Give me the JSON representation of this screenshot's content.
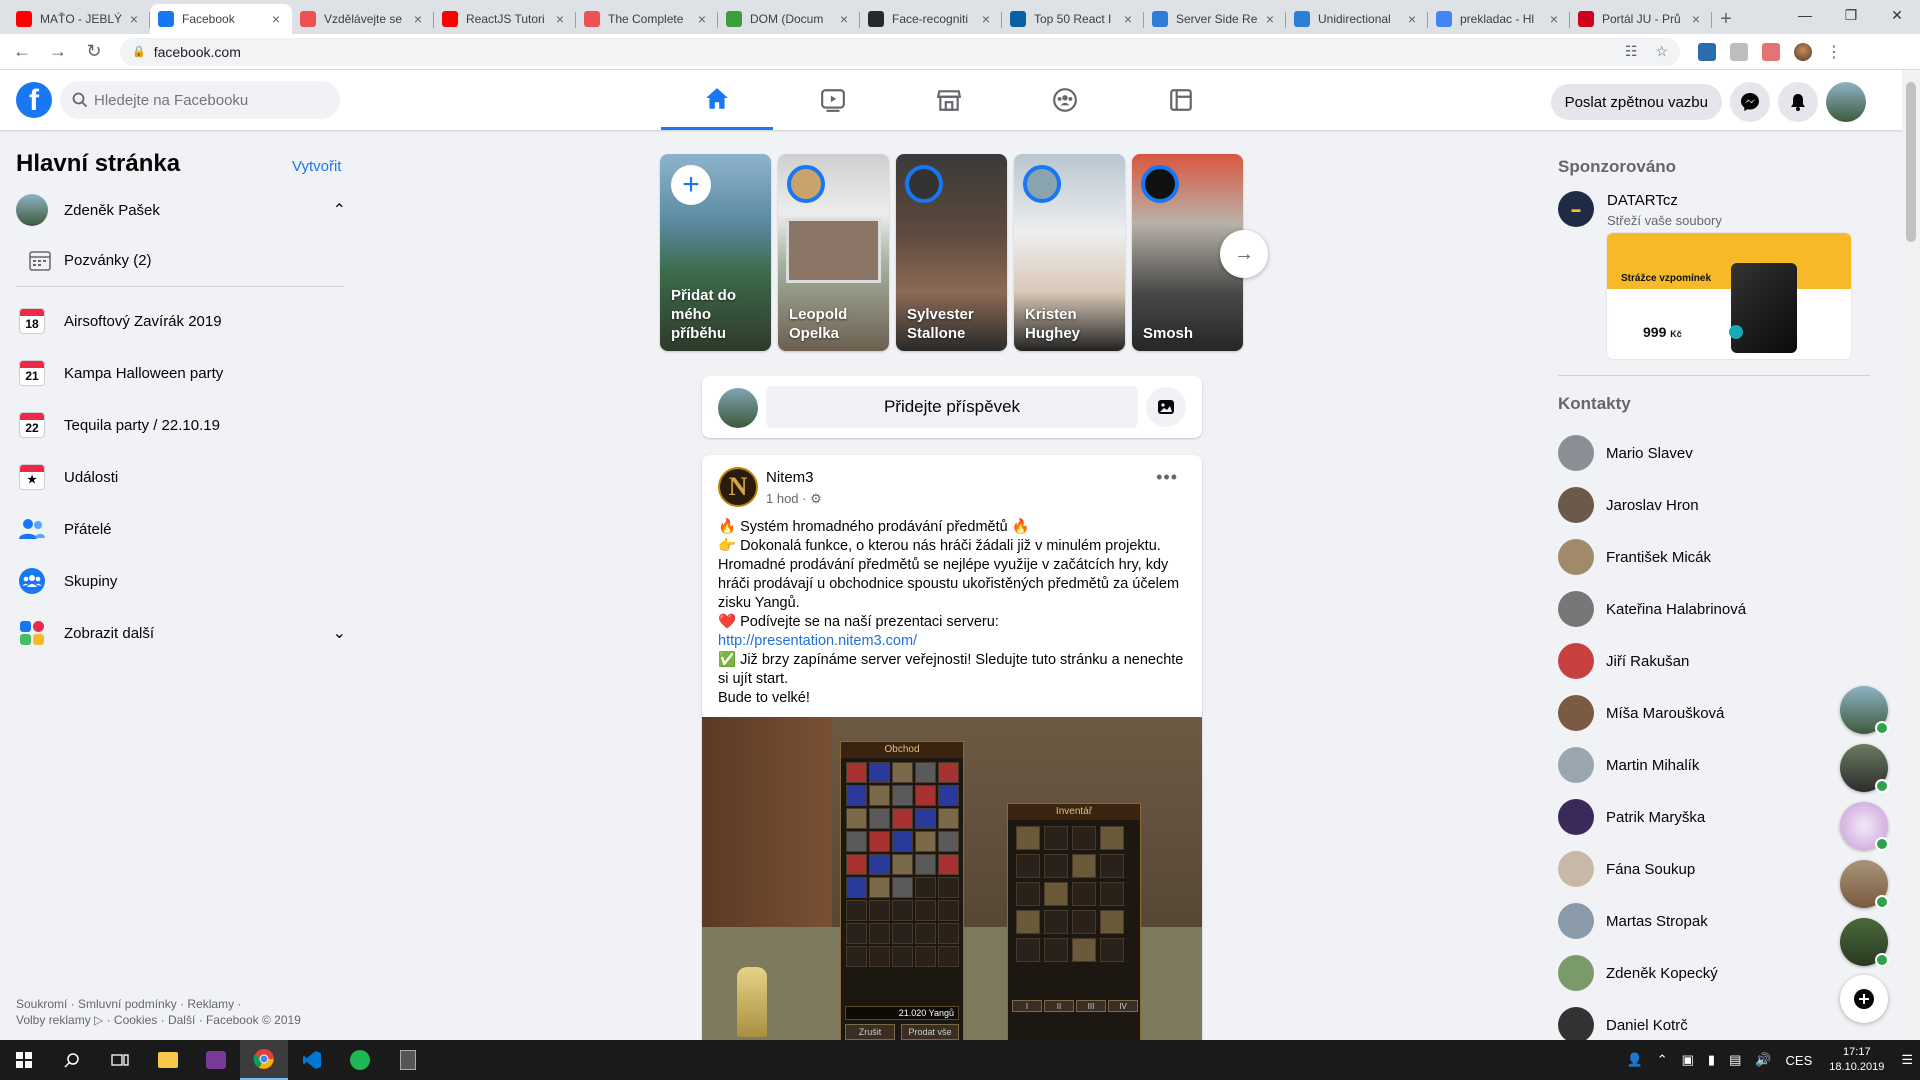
{
  "browser": {
    "tabs": [
      {
        "title": "MAŤO - JEBLÝ",
        "icon": "youtube-icon",
        "color": "#ff0000"
      },
      {
        "title": "Facebook",
        "icon": "facebook-icon",
        "color": "#1877f2",
        "active": true
      },
      {
        "title": "Vzdělávejte se",
        "icon": "udemy-icon",
        "color": "#ec5252"
      },
      {
        "title": "ReactJS Tutori",
        "icon": "youtube-icon",
        "color": "#ff0000"
      },
      {
        "title": "The Complete",
        "icon": "udemy-icon",
        "color": "#ec5252"
      },
      {
        "title": "DOM (Docum",
        "icon": "mdn-icon",
        "color": "#3c9f3c"
      },
      {
        "title": "Face-recogniti",
        "icon": "github-icon",
        "color": "#24292e"
      },
      {
        "title": "Top 50 React I",
        "icon": "edureka-icon",
        "color": "#0b5fa5"
      },
      {
        "title": "Server Side Re",
        "icon": "freecodecamp-icon",
        "color": "#2e7dd7"
      },
      {
        "title": "Unidirectional",
        "icon": "freecodecamp-icon",
        "color": "#2e7dd7"
      },
      {
        "title": "prekladac - Hl",
        "icon": "google-icon",
        "color": "#4285f4"
      },
      {
        "title": "Portál JU - Prů",
        "icon": "ju-icon",
        "color": "#d0021b"
      }
    ],
    "url": "facebook.com"
  },
  "header": {
    "search_placeholder": "Hledejte na Facebooku",
    "feedback_label": "Poslat zpětnou vazbu"
  },
  "sidebar": {
    "title": "Hlavní stránka",
    "create_label": "Vytvořit",
    "profile_name": "Zdeněk Pašek",
    "invitations": "Pozvánky (2)",
    "events": [
      {
        "day": "18",
        "name": "Airsoftový Zavírák 2019"
      },
      {
        "day": "21",
        "name": "Kampa Halloween party"
      },
      {
        "day": "22",
        "name": "Tequila party / 22.10.19"
      }
    ],
    "items": [
      {
        "label": "Události",
        "icon": "star-calendar-icon"
      },
      {
        "label": "Přátelé",
        "icon": "friends-icon"
      },
      {
        "label": "Skupiny",
        "icon": "groups-icon"
      },
      {
        "label": "Zobrazit další",
        "icon": "more-apps-icon"
      }
    ],
    "footer_line1": "Soukromí · Smluvní podmínky · Reklamy ·",
    "footer_line2": "Volby reklamy ▷ · Cookies · Další · Facebook © 2019"
  },
  "stories": [
    {
      "name": "Přidat do mého příběhu",
      "type": "add"
    },
    {
      "name": "Leopold Opelka"
    },
    {
      "name": "Sylvester Stallone"
    },
    {
      "name": "Kristen Hughey"
    },
    {
      "name": "Smosh"
    }
  ],
  "composer": {
    "label": "Přidejte příspěvek"
  },
  "post": {
    "author": "Nitem3",
    "time": "1 hod",
    "lines": [
      "🔥 Systém hromadného prodávání předmětů 🔥",
      "👉 Dokonalá funkce, o kterou nás hráči žádali již v minulém projektu. Hromadné prodávání předmětů se nejlépe využije v začátcích hry, kdy hráči prodávají u obchodnice spoustu ukořistěných předmětů za účelem zisku Yangů.",
      "❤️ Podívejte se na naší prezentaci serveru:"
    ],
    "link": "http://presentation.nitem3.com/",
    "lines2": [
      "✅ Již brzy zapínáme server veřejnosti! Sledujte tuto stránku a nenechte si ujít start.",
      "Bude to velké!"
    ],
    "game": {
      "shop_title": "Obchod",
      "inventory_title": "Inventář",
      "yang": "21.020 Yangů",
      "btn_cancel": "Zrušit",
      "btn_sell": "Prodat vše",
      "tabs": [
        "I",
        "II",
        "III",
        "IV"
      ]
    }
  },
  "right": {
    "sponsored_title": "Sponzorováno",
    "ad_name": "DATARTcz",
    "ad_sub": "Střeží vaše soubory",
    "ad_banner": "Strážce vzpomínek",
    "ad_price": "999",
    "ad_currency": "Kč",
    "contacts_title": "Kontakty",
    "contacts": [
      "Mario Slavev",
      "Jaroslav Hron",
      "František Micák",
      "Kateřina Halabrinová",
      "Jiří Rakušan",
      "Míša Maroušková",
      "Martin Mihalík",
      "Patrik Maryška",
      "Fána Soukup",
      "Martas Stropak",
      "Zdeněk Kopecký",
      "Daniel Kotrč"
    ]
  },
  "taskbar": {
    "lang": "CES",
    "time": "17:17",
    "date": "18.10.2019"
  }
}
